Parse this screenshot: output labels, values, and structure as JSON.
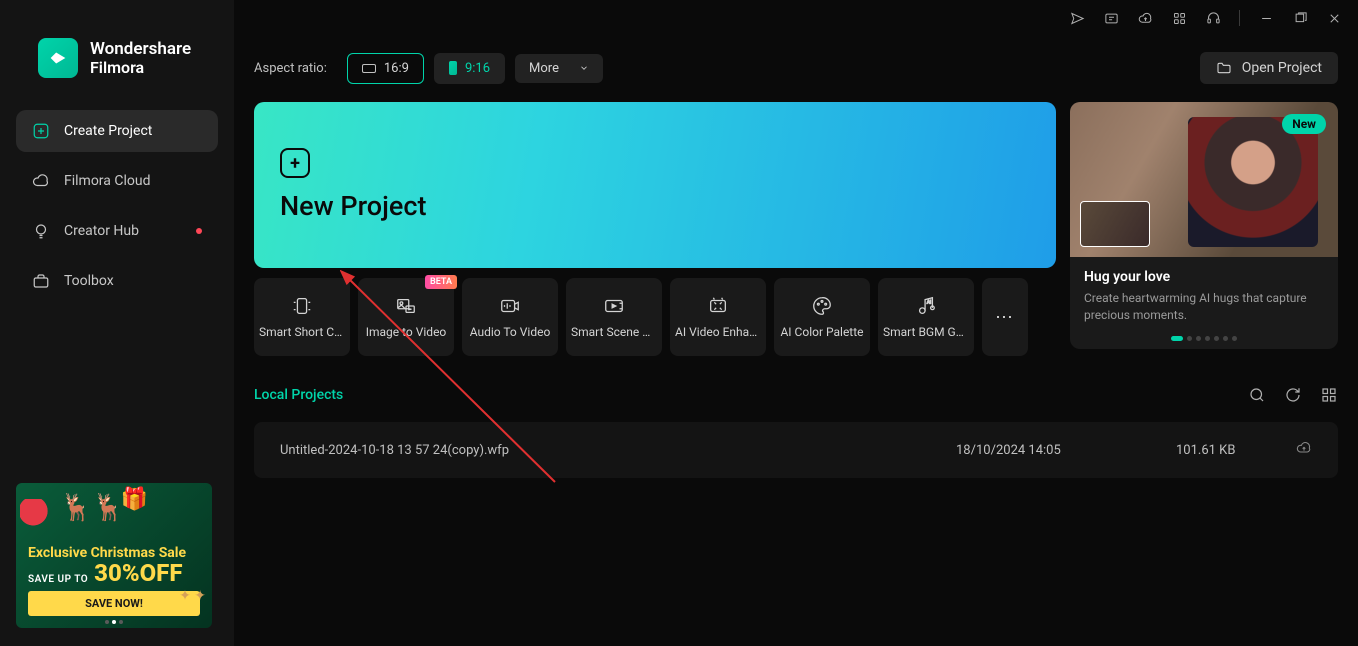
{
  "app": {
    "name1": "Wondershare",
    "name2": "Filmora"
  },
  "sidebar": {
    "items": [
      {
        "label": "Create Project"
      },
      {
        "label": "Filmora Cloud"
      },
      {
        "label": "Creator Hub"
      },
      {
        "label": "Toolbox"
      }
    ]
  },
  "promo": {
    "headline": "Exclusive Christmas Sale",
    "save_line": "SAVE UP TO",
    "percent": "30%OFF",
    "cta": "SAVE NOW!"
  },
  "toolbar": {
    "aspect_label": "Aspect ratio:",
    "ratio1": "16:9",
    "ratio2": "9:16",
    "more": "More",
    "open_project": "Open Project"
  },
  "new_project": {
    "label": "New Project"
  },
  "tools": [
    {
      "label": "Smart Short Cli..."
    },
    {
      "label": "Image to Video",
      "badge": "BETA"
    },
    {
      "label": "Audio To Video"
    },
    {
      "label": "Smart Scene Cut"
    },
    {
      "label": "AI Video Enhan..."
    },
    {
      "label": "AI Color Palette"
    },
    {
      "label": "Smart BGM Ge..."
    }
  ],
  "feature": {
    "pill": "New",
    "title": "Hug your love",
    "desc": "Create heartwarming AI hugs that capture precious moments."
  },
  "local": {
    "title": "Local Projects",
    "rows": [
      {
        "name": "Untitled-2024-10-18 13 57 24(copy).wfp",
        "date": "18/10/2024 14:05",
        "size": "101.61 KB"
      }
    ]
  }
}
